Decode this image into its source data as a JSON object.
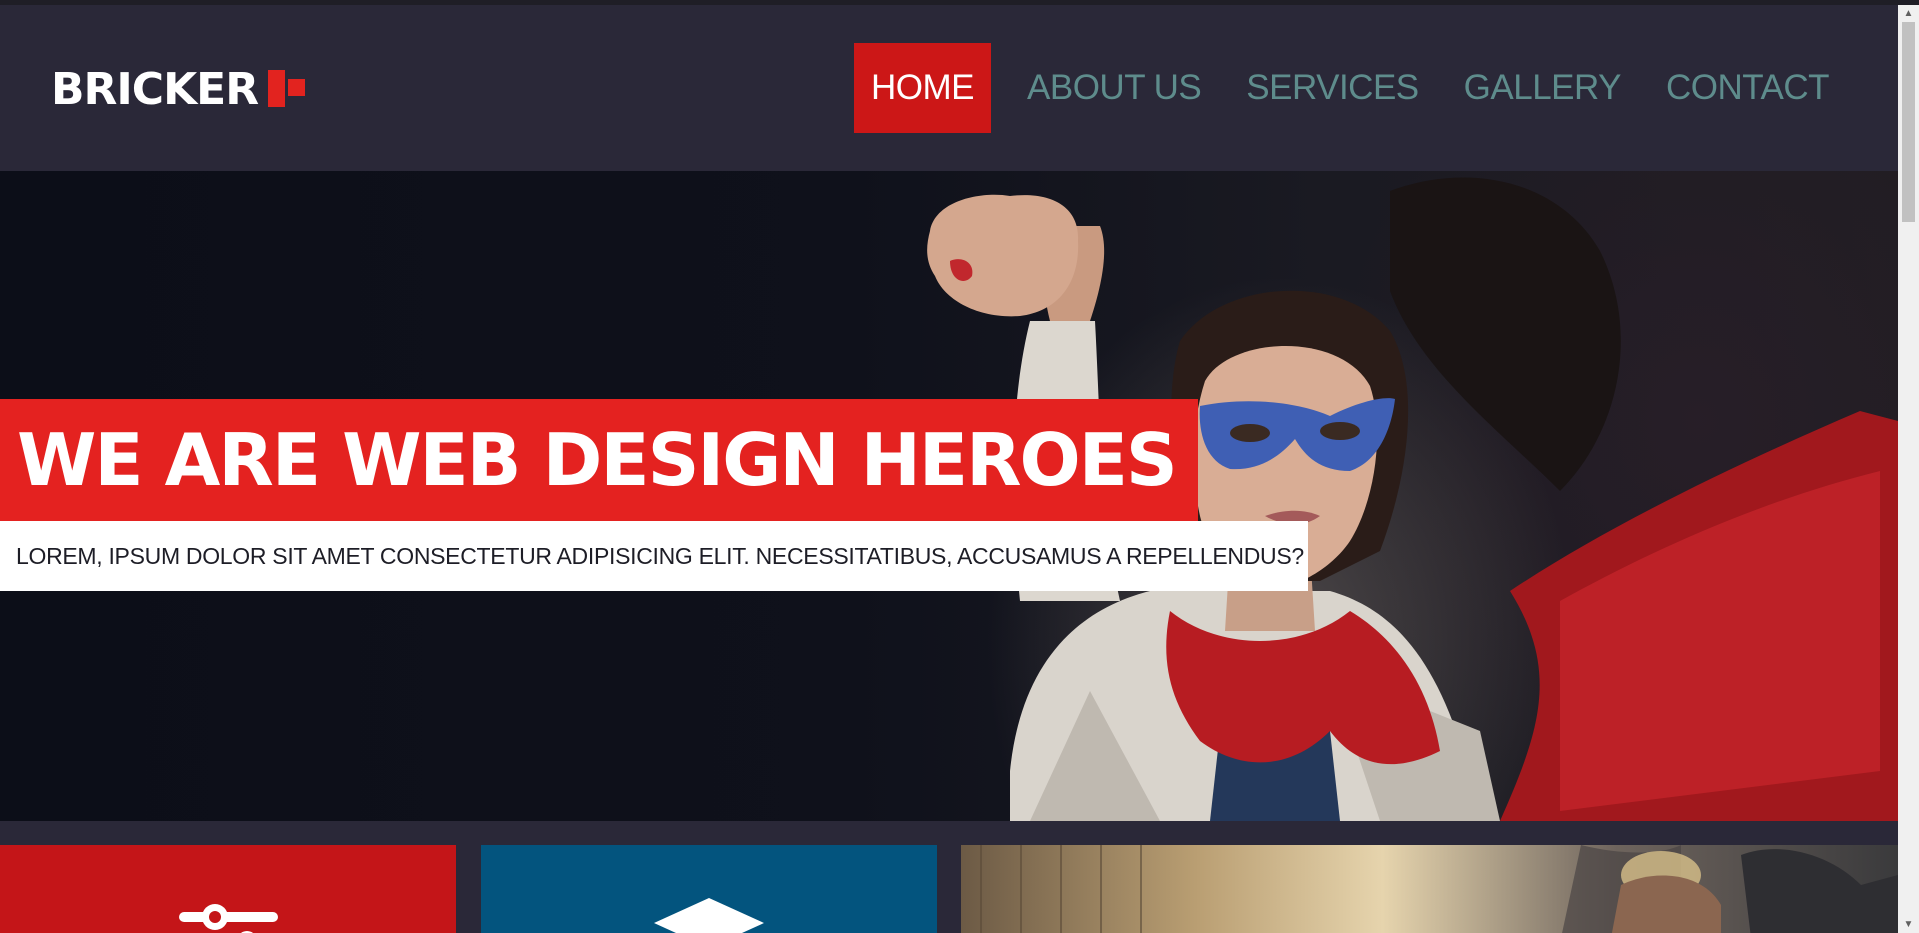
{
  "header": {
    "logo_text": "BRICKER",
    "nav": [
      {
        "label": "HOME",
        "active": true
      },
      {
        "label": "ABOUT US",
        "active": false
      },
      {
        "label": "SERVICES",
        "active": false
      },
      {
        "label": "GALLERY",
        "active": false
      },
      {
        "label": "CONTACT",
        "active": false
      }
    ]
  },
  "hero": {
    "headline": "WE ARE WEB DESIGN HEROES",
    "subline": "LOREM, IPSUM DOLOR SIT AMET CONSECTETUR ADIPISICING ELIT. NECESSITATIBUS, ACCUSAMUS A REPELLENDUS?"
  },
  "cards": [
    {
      "name": "card-red",
      "icon": "slider-icon",
      "color": "#c41518"
    },
    {
      "name": "card-blue",
      "icon": "diamond-icon",
      "color": "#03547e"
    },
    {
      "name": "card-photo",
      "icon": "",
      "color": ""
    }
  ],
  "colors": {
    "accent_red": "#e42220",
    "nav_active_bg": "#cc1717",
    "nav_text": "#5e8c8c",
    "header_bg": "#2a2838",
    "hero_bg": "#0e1019",
    "card_blue": "#03547e"
  }
}
